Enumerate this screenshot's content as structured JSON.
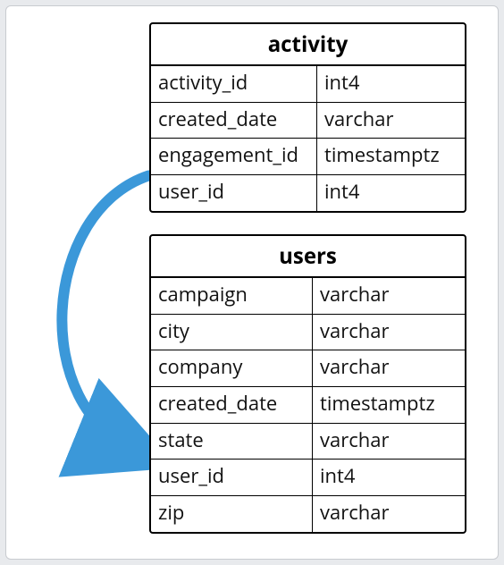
{
  "tables": {
    "activity": {
      "name": "activity",
      "columns": [
        {
          "name": "activity_id",
          "type": "int4"
        },
        {
          "name": "created_date",
          "type": "varchar"
        },
        {
          "name": "engagement_id",
          "type": "timestamptz"
        },
        {
          "name": "user_id",
          "type": "int4"
        }
      ]
    },
    "users": {
      "name": "users",
      "columns": [
        {
          "name": "campaign",
          "type": "varchar"
        },
        {
          "name": "city",
          "type": "varchar"
        },
        {
          "name": "company",
          "type": "varchar"
        },
        {
          "name": "created_date",
          "type": "timestamptz"
        },
        {
          "name": "state",
          "type": "varchar"
        },
        {
          "name": "user_id",
          "type": "int4"
        },
        {
          "name": "zip",
          "type": "varchar"
        }
      ]
    }
  },
  "relationship": {
    "from_table": "activity",
    "from_column": "user_id",
    "to_table": "users",
    "to_column": "user_id",
    "arrow_color": "#3b98d9"
  }
}
